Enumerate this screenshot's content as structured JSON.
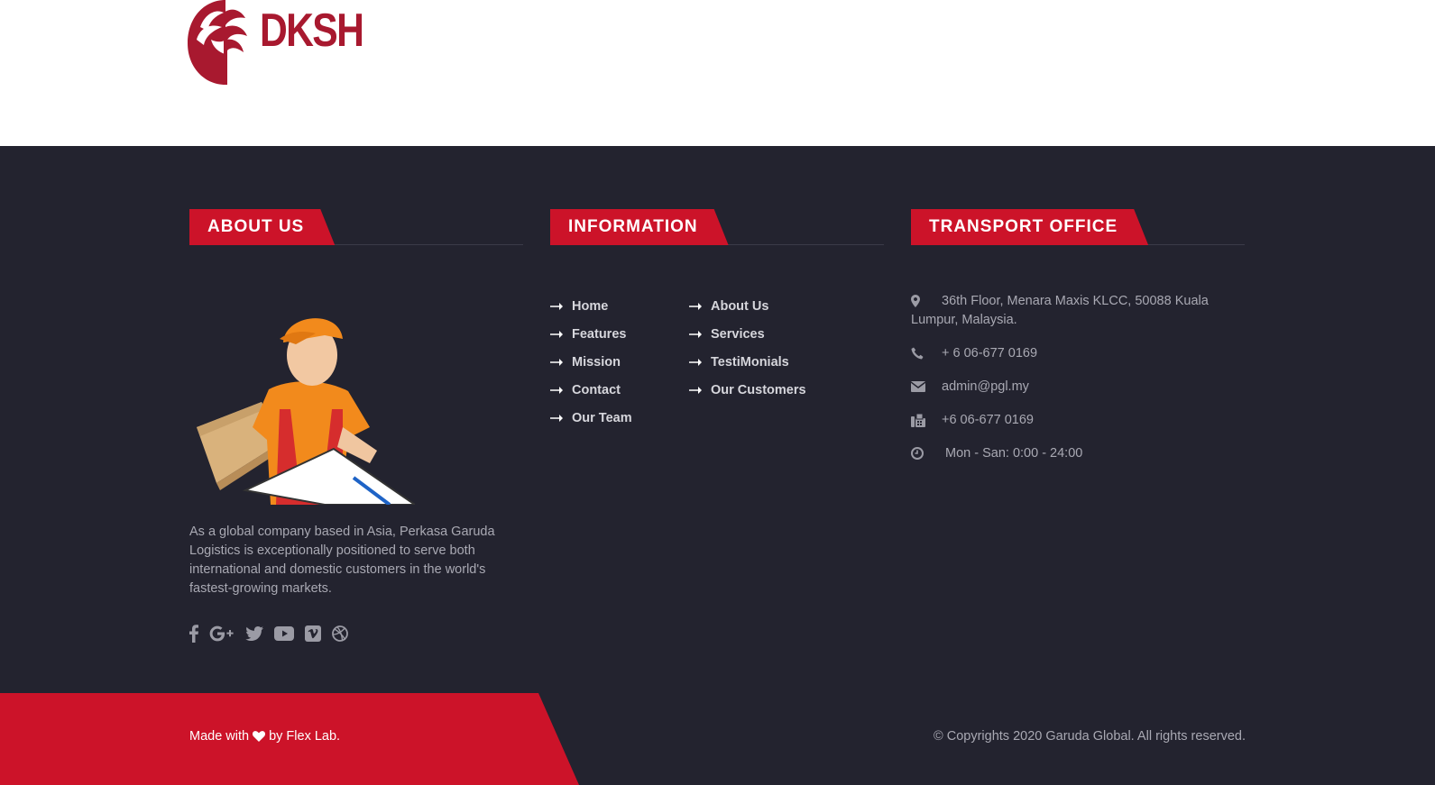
{
  "brand": {
    "logo_text": "DKSH",
    "accent": "#cc1329",
    "footer_bg": "#23232f"
  },
  "about": {
    "heading": "ABOUT US",
    "text": "As a global company based in Asia, Perkasa Garuda Logistics is exceptionally positioned to serve both international and domestic customers in the world's fastest-growing markets.",
    "socials": [
      "facebook-icon",
      "google-plus-icon",
      "twitter-icon",
      "youtube-icon",
      "vimeo-icon",
      "dribbble-icon"
    ]
  },
  "information": {
    "heading": "INFORMATION",
    "links_left": [
      "Home",
      "Features",
      "Mission",
      "Contact",
      "Our Team"
    ],
    "links_right": [
      "About Us",
      "Services",
      "TestiMonials",
      "Our Customers"
    ]
  },
  "office": {
    "heading": "TRANSPORT OFFICE",
    "address": "36th Floor, Menara Maxis KLCC, 50088 Kuala Lumpur, Malaysia.",
    "phone": "+ 6 06-677 0169",
    "email": "admin@pgl.my",
    "fax": "+6 06-677 0169",
    "hours": "Mon - San: 0:00 - 24:00"
  },
  "bottom": {
    "made_prefix": "Made with",
    "made_suffix": "by Flex Lab.",
    "copyright": "© Copyrights 2020 Garuda Global. All rights reserved."
  }
}
